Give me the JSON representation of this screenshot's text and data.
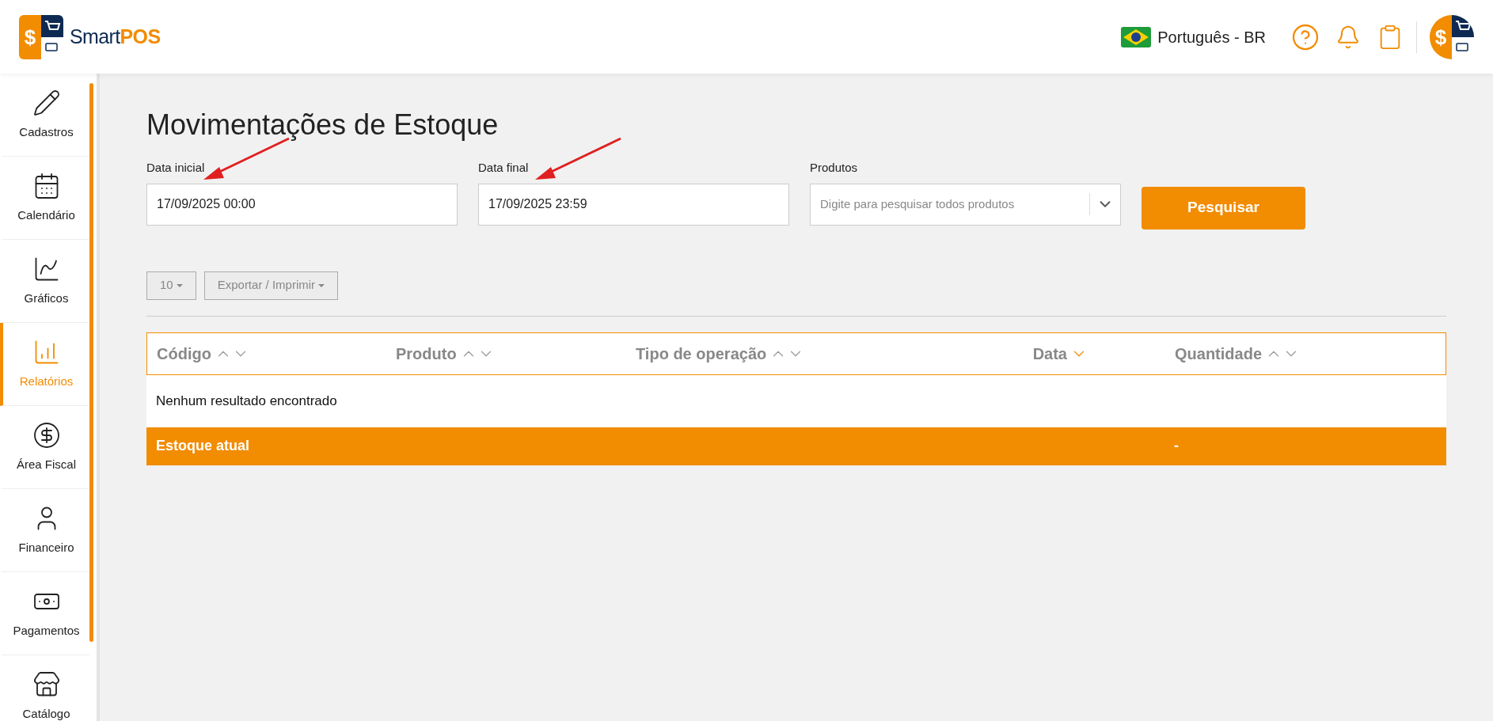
{
  "header": {
    "brand": {
      "symbol": "$",
      "name": "Smart",
      "accent": "POS"
    },
    "language": "Português - BR",
    "avatar_symbol": "$"
  },
  "sidebar": {
    "items": [
      {
        "label": "Cadastros",
        "selected": false
      },
      {
        "label": "Calendário",
        "selected": false
      },
      {
        "label": "Gráficos",
        "selected": false
      },
      {
        "label": "Relatórios",
        "selected": true
      },
      {
        "label": "Área Fiscal",
        "selected": false
      },
      {
        "label": "Financeiro",
        "selected": false
      },
      {
        "label": "Pagamentos",
        "selected": false
      },
      {
        "label": "Catálogo",
        "selected": false
      }
    ]
  },
  "page": {
    "title": "Movimentações de Estoque"
  },
  "filters": [
    {
      "kind": "date",
      "label": "Data inicial",
      "value": "17/09/2025 00:00",
      "annotated": true
    },
    {
      "kind": "date",
      "label": "Data final",
      "value": "17/09/2025 23:59",
      "annotated": true
    },
    {
      "kind": "select",
      "label": "Produtos",
      "placeholder": "Digite para pesquisar todos produtos",
      "annotated": false
    }
  ],
  "search_button": "Pesquisar",
  "toolbar": {
    "page_size": "10",
    "export": "Exportar / Imprimir"
  },
  "table": {
    "columns": [
      {
        "label": "Código",
        "sorted": false
      },
      {
        "label": "Produto",
        "sorted": false
      },
      {
        "label": "Tipo de operação",
        "sorted": false
      },
      {
        "label": "Data",
        "sorted": true
      },
      {
        "label": "Quantidade",
        "sorted": false
      }
    ],
    "empty_message": "Nenhum resultado encontrado",
    "footer": {
      "label": "Estoque atual",
      "quantity": "-"
    }
  }
}
